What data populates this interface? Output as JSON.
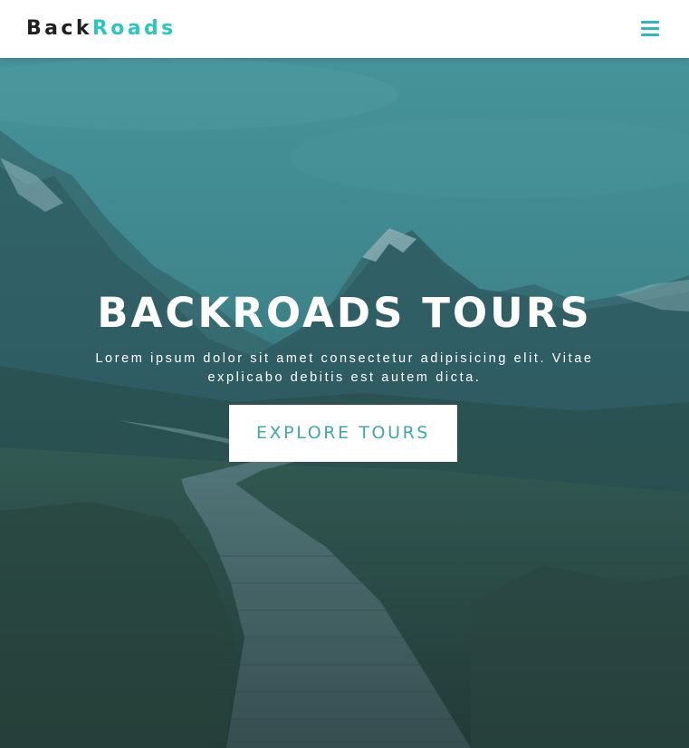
{
  "navbar": {
    "logo_part1": "Back",
    "logo_part2": "Roads",
    "menu_icon": "hamburger-menu-icon"
  },
  "hero": {
    "title": "BACKROADS TOURS",
    "text": "Lorem ipsum dolor sit amet consectetur adipisicing elit. Vitae explicabo debitis est autem dicta.",
    "button_label": "EXPLORE TOURS",
    "background_image": "mountain valley boardwalk trail photo"
  },
  "colors": {
    "brand_dark": "#1f1f1f",
    "brand_accent": "#2fc4c4",
    "menu_icon": "#2fb8ba",
    "button_text": "#3fa8ad",
    "hero_overlay": "#2c7e84"
  }
}
